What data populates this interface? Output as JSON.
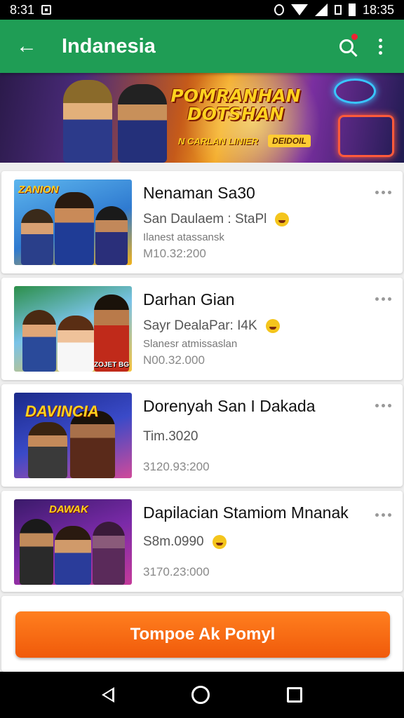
{
  "status_bar": {
    "left_text": "8:31",
    "time": "18:35",
    "icons": [
      "box-icon",
      "alarm-icon",
      "wifi-icon",
      "signal-icon",
      "sim-icon",
      "battery-icon"
    ]
  },
  "app_bar": {
    "title": "Indanesia",
    "icons": [
      "back-arrow-icon",
      "search-icon",
      "more-vert-icon"
    ],
    "color": "#1f9d55"
  },
  "banner": {
    "title_line1": "POMRANHAN",
    "title_line2": "DOTSHAN",
    "tag1": "N CARLAN LINIER",
    "tag2": "DEIDOIL"
  },
  "items": [
    {
      "thumb_logo": "ZANION",
      "thumb_corner": "",
      "name": "Nenaman Sa30",
      "sub": "San Daulaem : StaPl",
      "meta": "Ilanest atassansk",
      "price": "M10.32:200"
    },
    {
      "thumb_logo": "",
      "thumb_corner": "ZOJET BG",
      "name": "Darhan Gian",
      "sub": "Sayr DealaPar: I4K",
      "meta": "Slanesr atmissaslan",
      "price": "N00.32.000"
    },
    {
      "thumb_logo": "DAVINCIA",
      "thumb_corner": "",
      "name": "Dorenyah San I Dakada",
      "sub": "Tim.3020",
      "meta": "",
      "price": "3120.93:200"
    },
    {
      "thumb_logo": "DAWAK",
      "thumb_corner": "",
      "name": "Dapilacian Stamiom Mnanak",
      "sub": "S8m.0990",
      "meta": "",
      "price": "3170.23:000"
    }
  ],
  "cta": {
    "label": "Tompoe Ak Pomyl",
    "color": "#f26a12"
  },
  "nav_bar": {
    "icons": [
      "nav-back-icon",
      "nav-home-icon",
      "nav-recents-icon"
    ]
  }
}
